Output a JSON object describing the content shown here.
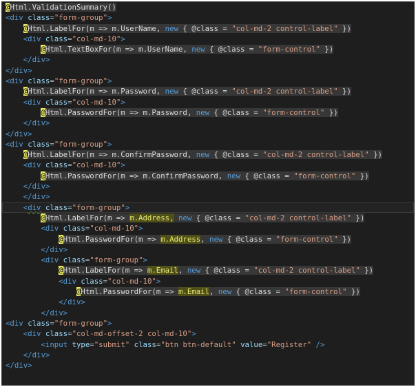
{
  "editor": {
    "language": "razor",
    "colors": {
      "background": "#1e1e1e",
      "tag": "#569cd6",
      "attribute": "#9cdcfe",
      "attribute_value": "#d69d85",
      "razor_background": "#373737",
      "razor_at_highlight": "#eaea62",
      "reference_highlight": "#4f4f1a"
    },
    "current_line": 19,
    "lines": [
      {
        "indent": 0,
        "tokens": [
          {
            "t": "razor",
            "c": [
              {
                "t": "at",
                "v": "@"
              },
              {
                "t": "txt",
                "v": "Html.ValidationSummary()"
              }
            ]
          }
        ]
      },
      {
        "indent": 0,
        "tokens": [
          {
            "t": "tag",
            "v": "<div "
          },
          {
            "t": "attr",
            "v": "class"
          },
          {
            "t": "op",
            "v": "="
          },
          {
            "t": "attrval",
            "v": "\"form-group\""
          },
          {
            "t": "tag",
            "v": ">"
          }
        ]
      },
      {
        "indent": 4,
        "tokens": [
          {
            "t": "razor",
            "c": [
              {
                "t": "at",
                "v": "@"
              },
              {
                "t": "txt",
                "v": "Html.LabelFor(m => m.UserName, "
              },
              {
                "t": "kw",
                "v": "new"
              },
              {
                "t": "txt",
                "v": " { @class = "
              },
              {
                "t": "str",
                "v": "\"col-md-2 control-label\""
              },
              {
                "t": "txt",
                "v": " })"
              }
            ]
          }
        ]
      },
      {
        "indent": 4,
        "tokens": [
          {
            "t": "tag",
            "v": "<div "
          },
          {
            "t": "attr",
            "v": "class"
          },
          {
            "t": "op",
            "v": "="
          },
          {
            "t": "attrval",
            "v": "\"col-md-10\""
          },
          {
            "t": "tag",
            "v": ">"
          }
        ]
      },
      {
        "indent": 8,
        "tokens": [
          {
            "t": "razor",
            "c": [
              {
                "t": "at",
                "v": "@"
              },
              {
                "t": "txt",
                "v": "Html.TextBoxFor(m => m.UserName, "
              },
              {
                "t": "kw",
                "v": "new"
              },
              {
                "t": "txt",
                "v": " { @class = "
              },
              {
                "t": "str",
                "v": "\"form-control\""
              },
              {
                "t": "txt",
                "v": " })"
              }
            ]
          }
        ]
      },
      {
        "indent": 4,
        "tokens": [
          {
            "t": "tag",
            "v": "</div>"
          }
        ]
      },
      {
        "indent": 0,
        "tokens": [
          {
            "t": "tag",
            "v": "</div>"
          }
        ]
      },
      {
        "indent": 0,
        "tokens": [
          {
            "t": "tag",
            "v": "<div "
          },
          {
            "t": "attr",
            "v": "class"
          },
          {
            "t": "op",
            "v": "="
          },
          {
            "t": "attrval",
            "v": "\"form-group\""
          },
          {
            "t": "tag",
            "v": ">"
          }
        ]
      },
      {
        "indent": 4,
        "tokens": [
          {
            "t": "razor",
            "c": [
              {
                "t": "at",
                "v": "@"
              },
              {
                "t": "txt",
                "v": "Html.LabelFor(m => m.Password, "
              },
              {
                "t": "kw",
                "v": "new"
              },
              {
                "t": "txt",
                "v": " { @class = "
              },
              {
                "t": "str",
                "v": "\"col-md-2 control-label\""
              },
              {
                "t": "txt",
                "v": " })"
              }
            ]
          }
        ]
      },
      {
        "indent": 4,
        "tokens": [
          {
            "t": "tag",
            "v": "<div "
          },
          {
            "t": "attr",
            "v": "class"
          },
          {
            "t": "op",
            "v": "="
          },
          {
            "t": "attrval",
            "v": "\"col-md-10\""
          },
          {
            "t": "tag",
            "v": ">"
          }
        ]
      },
      {
        "indent": 8,
        "tokens": [
          {
            "t": "razor",
            "c": [
              {
                "t": "at",
                "v": "@"
              },
              {
                "t": "txt",
                "v": "Html.PasswordFor(m => m.Password, "
              },
              {
                "t": "kw",
                "v": "new"
              },
              {
                "t": "txt",
                "v": " { @class = "
              },
              {
                "t": "str",
                "v": "\"form-control\""
              },
              {
                "t": "txt",
                "v": " })"
              }
            ]
          }
        ]
      },
      {
        "indent": 4,
        "tokens": [
          {
            "t": "tag",
            "v": "</div>"
          }
        ]
      },
      {
        "indent": 0,
        "tokens": [
          {
            "t": "tag",
            "v": "</div>"
          }
        ]
      },
      {
        "indent": 0,
        "tokens": [
          {
            "t": "tag",
            "v": "<div "
          },
          {
            "t": "attr",
            "v": "class"
          },
          {
            "t": "op",
            "v": "="
          },
          {
            "t": "attrval",
            "v": "\"form-group\""
          },
          {
            "t": "tag",
            "v": ">"
          }
        ]
      },
      {
        "indent": 4,
        "tokens": [
          {
            "t": "razor",
            "c": [
              {
                "t": "at",
                "v": "@"
              },
              {
                "t": "txt",
                "v": "Html.LabelFor(m => m.ConfirmPassword, "
              },
              {
                "t": "kw",
                "v": "new"
              },
              {
                "t": "txt",
                "v": " { @class = "
              },
              {
                "t": "str",
                "v": "\"col-md-2 control-label\""
              },
              {
                "t": "txt",
                "v": " })"
              }
            ]
          }
        ]
      },
      {
        "indent": 4,
        "tokens": [
          {
            "t": "tag",
            "v": "<div "
          },
          {
            "t": "attr",
            "v": "class"
          },
          {
            "t": "op",
            "v": "="
          },
          {
            "t": "attrval",
            "v": "\"col-md-10\""
          },
          {
            "t": "tag",
            "v": ">"
          }
        ]
      },
      {
        "indent": 8,
        "tokens": [
          {
            "t": "razor",
            "c": [
              {
                "t": "at",
                "v": "@"
              },
              {
                "t": "txt",
                "v": "Html.PasswordFor(m => m.ConfirmPassword, "
              },
              {
                "t": "kw",
                "v": "new"
              },
              {
                "t": "txt",
                "v": " { @class = "
              },
              {
                "t": "str",
                "v": "\"form-control\""
              },
              {
                "t": "txt",
                "v": " })"
              }
            ]
          }
        ]
      },
      {
        "indent": 4,
        "tokens": [
          {
            "t": "tag",
            "v": "</div>"
          }
        ]
      },
      {
        "indent": 4,
        "tokens": [
          {
            "t": "tag",
            "v": "</div>"
          }
        ]
      },
      {
        "indent": 4,
        "tokens": [
          {
            "t": "tag",
            "v": "<"
          },
          {
            "t": "squiggle",
            "v": "div"
          },
          {
            "t": "tag",
            "v": " "
          },
          {
            "t": "attr",
            "v": "class"
          },
          {
            "t": "op",
            "v": "="
          },
          {
            "t": "attrval",
            "v": "\"form-group\""
          },
          {
            "t": "tag",
            "v": ">"
          }
        ]
      },
      {
        "indent": 8,
        "tokens": [
          {
            "t": "razor",
            "c": [
              {
                "t": "at",
                "v": "@"
              },
              {
                "t": "txt",
                "v": "Html.LabelFor(m => "
              },
              {
                "t": "hl",
                "v": "m.Address,"
              },
              {
                "t": "txt",
                "v": " "
              },
              {
                "t": "kw",
                "v": "new"
              },
              {
                "t": "txt",
                "v": " { @class = "
              },
              {
                "t": "str",
                "v": "\"col-md-2 control-label\""
              },
              {
                "t": "txt",
                "v": " })"
              }
            ]
          }
        ]
      },
      {
        "indent": 8,
        "tokens": [
          {
            "t": "tag",
            "v": "<div "
          },
          {
            "t": "attr",
            "v": "class"
          },
          {
            "t": "op",
            "v": "="
          },
          {
            "t": "attrval",
            "v": "\"col-md-10\""
          },
          {
            "t": "tag",
            "v": ">"
          }
        ]
      },
      {
        "indent": 12,
        "tokens": [
          {
            "t": "razor",
            "c": [
              {
                "t": "at",
                "v": "@"
              },
              {
                "t": "txt",
                "v": "Html.PasswordFor(m => "
              },
              {
                "t": "hl",
                "v": "m.Address"
              },
              {
                "t": "txt",
                "v": ", "
              },
              {
                "t": "kw",
                "v": "new"
              },
              {
                "t": "txt",
                "v": " { @class = "
              },
              {
                "t": "str",
                "v": "\"form-control\""
              },
              {
                "t": "txt",
                "v": " })"
              }
            ]
          }
        ]
      },
      {
        "indent": 8,
        "tokens": [
          {
            "t": "tag",
            "v": "</div>"
          }
        ]
      },
      {
        "indent": 8,
        "tokens": [
          {
            "t": "tag",
            "v": "<div "
          },
          {
            "t": "attr",
            "v": "class"
          },
          {
            "t": "op",
            "v": "="
          },
          {
            "t": "attrval",
            "v": "\"form-group\""
          },
          {
            "t": "tag",
            "v": ">"
          }
        ]
      },
      {
        "indent": 12,
        "tokens": [
          {
            "t": "razor",
            "c": [
              {
                "t": "at",
                "v": "@"
              },
              {
                "t": "txt",
                "v": "Html.LabelFor(m => "
              },
              {
                "t": "hl",
                "v": "m.Email"
              },
              {
                "t": "txt",
                "v": ", "
              },
              {
                "t": "kw",
                "v": "new"
              },
              {
                "t": "txt",
                "v": " { @class = "
              },
              {
                "t": "str",
                "v": "\"col-md-2 control-label\""
              },
              {
                "t": "txt",
                "v": " })"
              }
            ]
          }
        ]
      },
      {
        "indent": 12,
        "tokens": [
          {
            "t": "tag",
            "v": "<div "
          },
          {
            "t": "attr",
            "v": "class"
          },
          {
            "t": "op",
            "v": "="
          },
          {
            "t": "attrval",
            "v": "\"col-md-10\""
          },
          {
            "t": "tag",
            "v": ">"
          }
        ]
      },
      {
        "indent": 16,
        "tokens": [
          {
            "t": "razor",
            "c": [
              {
                "t": "at",
                "v": "@"
              },
              {
                "t": "txt",
                "v": "Html.PasswordFor(m => "
              },
              {
                "t": "hl",
                "v": "m.Email"
              },
              {
                "t": "txt",
                "v": ", "
              },
              {
                "t": "kw",
                "v": "new"
              },
              {
                "t": "txt",
                "v": " { @class = "
              },
              {
                "t": "str",
                "v": "\"form-control\""
              },
              {
                "t": "txt",
                "v": " })"
              }
            ]
          }
        ]
      },
      {
        "indent": 12,
        "tokens": [
          {
            "t": "tag",
            "v": "</div>"
          }
        ]
      },
      {
        "indent": 8,
        "tokens": [
          {
            "t": "tag",
            "v": "</div>"
          }
        ]
      },
      {
        "indent": 0,
        "tokens": [
          {
            "t": "tag",
            "v": "<div "
          },
          {
            "t": "attr",
            "v": "class"
          },
          {
            "t": "op",
            "v": "="
          },
          {
            "t": "attrval",
            "v": "\"form-group\""
          },
          {
            "t": "tag",
            "v": ">"
          }
        ]
      },
      {
        "indent": 4,
        "tokens": [
          {
            "t": "tag",
            "v": "<div "
          },
          {
            "t": "attr",
            "v": "class"
          },
          {
            "t": "op",
            "v": "="
          },
          {
            "t": "attrval",
            "v": "\"col-md-offset-2 col-md-10\""
          },
          {
            "t": "tag",
            "v": ">"
          }
        ]
      },
      {
        "indent": 8,
        "tokens": [
          {
            "t": "tag",
            "v": "<input "
          },
          {
            "t": "attr",
            "v": "type"
          },
          {
            "t": "op",
            "v": "="
          },
          {
            "t": "attrval",
            "v": "\"submit\""
          },
          {
            "t": "tag",
            "v": " "
          },
          {
            "t": "attr",
            "v": "class"
          },
          {
            "t": "op",
            "v": "="
          },
          {
            "t": "attrval",
            "v": "\"btn btn-default\""
          },
          {
            "t": "tag",
            "v": " "
          },
          {
            "t": "attr",
            "v": "value"
          },
          {
            "t": "op",
            "v": "="
          },
          {
            "t": "attrval",
            "v": "\"Register\""
          },
          {
            "t": "tag",
            "v": " />"
          }
        ]
      },
      {
        "indent": 4,
        "tokens": [
          {
            "t": "tag",
            "v": "</div>"
          }
        ]
      },
      {
        "indent": 0,
        "tokens": [
          {
            "t": "tag",
            "v": "</div>"
          }
        ]
      }
    ]
  }
}
